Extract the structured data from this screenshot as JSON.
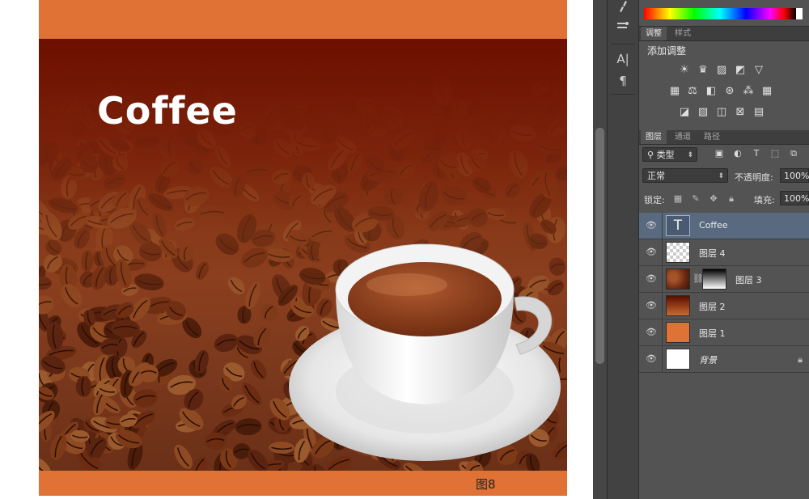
{
  "document": {
    "title_text": "Coffee",
    "figure_label": "图8",
    "colors": {
      "band": "#e07236",
      "dark_top": "#5a0d00",
      "canvas_bg": "#ffffff"
    }
  },
  "tool_strip": {
    "icons": [
      "brush-settings-icon",
      "clone-source-icon",
      "character-icon",
      "paragraph-icon"
    ],
    "character_glyph": "A|",
    "paragraph_glyph": "¶"
  },
  "adjustments": {
    "tabs": [
      {
        "label": "调整"
      },
      {
        "label": "样式"
      }
    ],
    "title": "添加调整",
    "icons": [
      "brightness-contrast-icon",
      "levels-icon",
      "curves-icon",
      "exposure-icon",
      "vibrance-icon",
      "hue-saturation-icon",
      "color-balance-icon",
      "black-white-icon",
      "photo-filter-icon",
      "channel-mixer-icon",
      "color-lookup-icon",
      "invert-icon",
      "posterize-icon",
      "threshold-icon",
      "selective-color-icon",
      "gradient-map-icon"
    ]
  },
  "layers": {
    "tabs": [
      {
        "label": "图层"
      },
      {
        "label": "通道"
      },
      {
        "label": "路径"
      }
    ],
    "filter_select": "类型",
    "blend_mode": "正常",
    "opacity_label": "不透明度:",
    "opacity_value": "100%",
    "lock_label": "锁定:",
    "fill_label": "填充:",
    "fill_value": "100%",
    "items": [
      {
        "name": "Coffee",
        "kind": "text",
        "selected": true,
        "thumb_glyph": "T"
      },
      {
        "name": "图层 4",
        "kind": "pixel-transparent",
        "selected": false
      },
      {
        "name": "图层 3",
        "kind": "pixel-mask",
        "selected": false
      },
      {
        "name": "图层 2",
        "kind": "gradient",
        "selected": false
      },
      {
        "name": "图层 1",
        "kind": "solid",
        "selected": false
      },
      {
        "name": "背景",
        "kind": "background",
        "selected": false,
        "locked": true
      }
    ]
  }
}
